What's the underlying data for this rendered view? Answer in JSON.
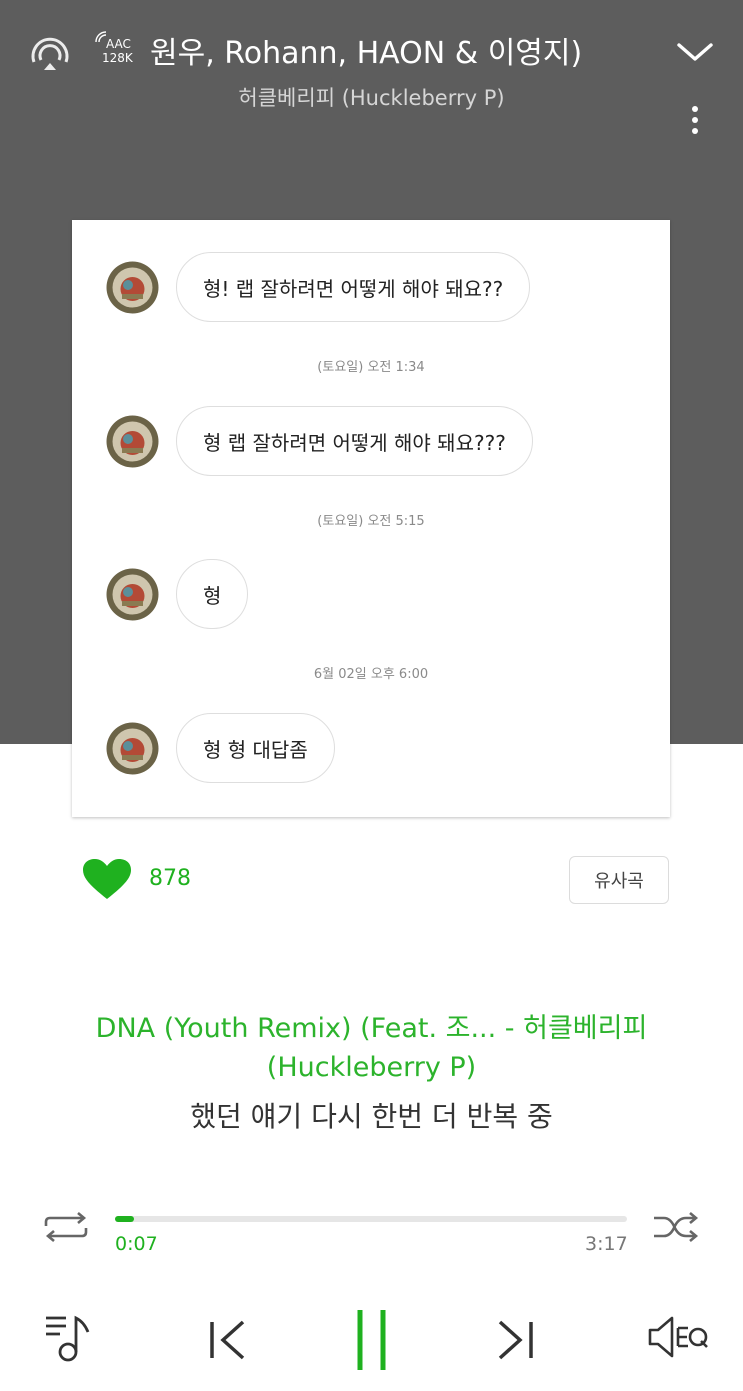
{
  "header": {
    "title": "원우, Rohann, HAON & 이영지)",
    "artist": "허클베리피 (Huckleberry P)",
    "codec": "AAC",
    "bitrate": "128K"
  },
  "chat": {
    "messages": [
      {
        "text": "형! 랩 잘하려면 어떻게 해야 돼요??"
      },
      {
        "text": "형 랩 잘하려면 어떻게 해야 돼요???"
      },
      {
        "text": "형"
      },
      {
        "text": "형 형 대답좀"
      }
    ],
    "timestamps": [
      "(토요일) 오전 1:34",
      "(토요일) 오전 5:15",
      "6월 02일 오후 6:00"
    ]
  },
  "like": {
    "count": "878"
  },
  "similar_button": "유사곡",
  "song": {
    "line1": "DNA (Youth Remix) (Feat. 조... - 허클베리피",
    "line2": "(Huckleberry P)",
    "lyric": "했던 얘기 다시 한번 더 반복 중"
  },
  "playback": {
    "current_time": "0:07",
    "total_time": "3:17",
    "progress": 0.037
  },
  "colors": {
    "accent": "#1fb11f",
    "header_bg": "#5d5d5d"
  }
}
